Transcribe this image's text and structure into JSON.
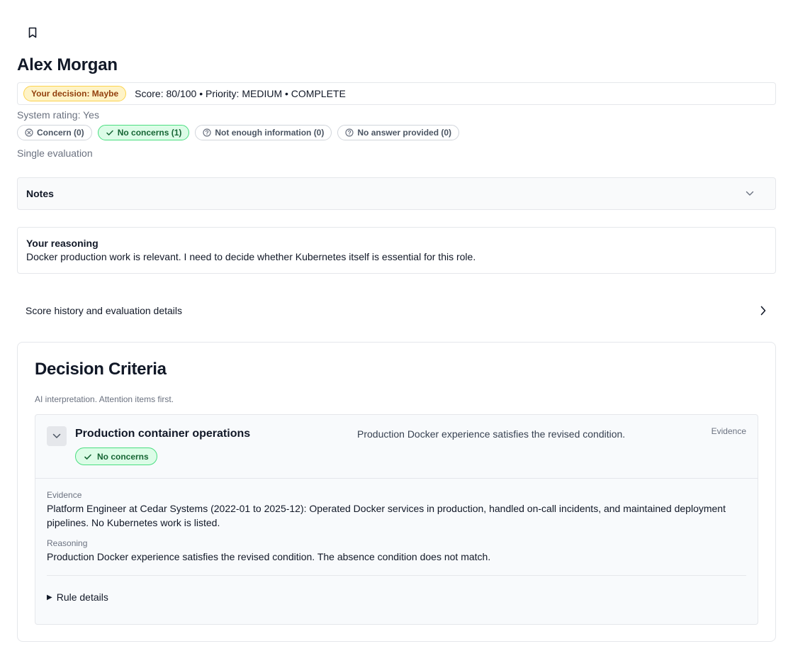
{
  "candidate": {
    "name": "Alex Morgan"
  },
  "summary": {
    "decision_label": "Your decision: Maybe",
    "details": "Score: 80/100 • Priority: MEDIUM • COMPLETE",
    "system_rating": "System rating: Yes"
  },
  "filters": [
    {
      "label": "Concern (0)",
      "icon": "x-circle-icon",
      "active": false
    },
    {
      "label": "No concerns (1)",
      "icon": "check-icon",
      "active": true
    },
    {
      "label": "Not enough information (0)",
      "icon": "question-circle-icon",
      "active": false
    },
    {
      "label": "No answer provided (0)",
      "icon": "question-circle-icon",
      "active": false
    }
  ],
  "evaluation_mode": "Single evaluation",
  "notes": {
    "label": "Notes"
  },
  "reasoning": {
    "title": "Your reasoning",
    "text": "Docker production work is relevant. I need to decide whether Kubernetes itself is essential for this role."
  },
  "history": {
    "label": "Score history and evaluation details"
  },
  "criteria": {
    "title": "Decision Criteria",
    "subtitle": "AI interpretation. Attention items first.",
    "items": [
      {
        "name": "Production container operations",
        "status": "No concerns",
        "summary": "Production Docker experience satisfies the revised condition.",
        "evidence_link": "Evidence",
        "evidence_label": "Evidence",
        "evidence_text": "Platform Engineer at Cedar Systems (2022-01 to 2025-12): Operated Docker services in production, handled on-call incidents, and maintained deployment pipelines. No Kubernetes work is listed.",
        "reasoning_label": "Reasoning",
        "reasoning_text": "Production Docker experience satisfies the revised condition. The absence condition does not match.",
        "rule_details_label": "Rule details"
      }
    ]
  },
  "colors": {
    "decision_bg": "#fef3c7",
    "decision_text": "#92400e",
    "success_bg": "#dcfce7",
    "success_text": "#166534",
    "muted_text": "#6b7280"
  }
}
